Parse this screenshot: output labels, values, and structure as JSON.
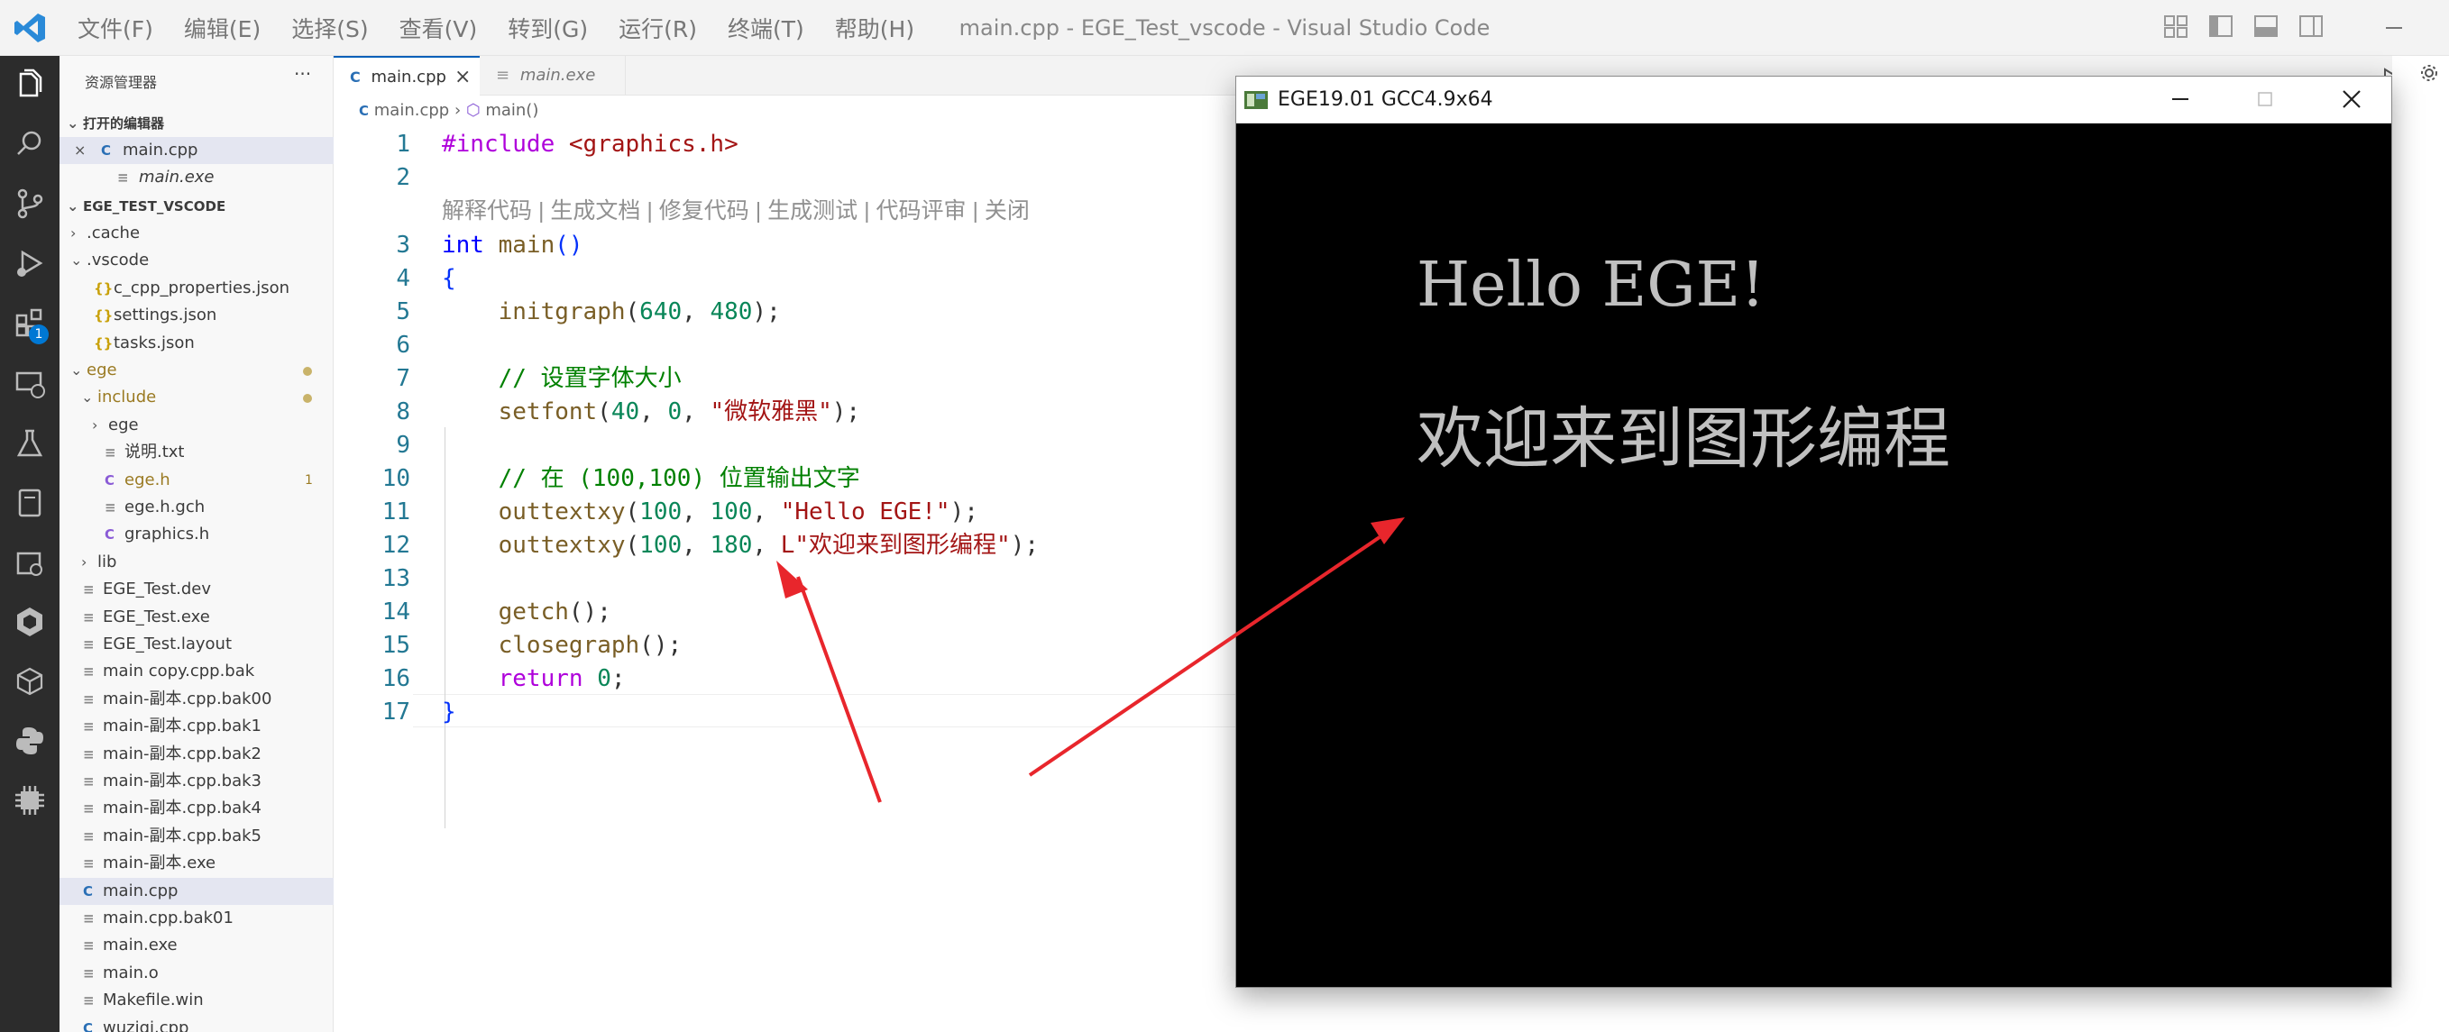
{
  "window": {
    "title": "main.cpp - EGE_Test_vscode - Visual Studio Code"
  },
  "menu": [
    "文件(F)",
    "编辑(E)",
    "选择(S)",
    "查看(V)",
    "转到(G)",
    "运行(R)",
    "终端(T)",
    "帮助(H)"
  ],
  "sidebar": {
    "title": "资源管理器",
    "more": "···",
    "open_editors_label": "打开的编辑器",
    "open_editors": [
      {
        "label": "main.cpp",
        "icon": "C"
      },
      {
        "label": "main.exe",
        "icon": "≡"
      }
    ],
    "project_label": "EGE_TEST_VSCODE",
    "tree": [
      {
        "label": ".cache",
        "chev": "›",
        "icon": ""
      },
      {
        "label": ".vscode",
        "chev": "⌄",
        "icon": ""
      },
      {
        "label": "c_cpp_properties.json",
        "chev": "",
        "icon": "{}"
      },
      {
        "label": "settings.json",
        "chev": "",
        "icon": "{}"
      },
      {
        "label": "tasks.json",
        "chev": "",
        "icon": "{}"
      },
      {
        "label": "ege",
        "chev": "⌄",
        "icon": ""
      },
      {
        "label": "include",
        "chev": "⌄",
        "icon": ""
      },
      {
        "label": "ege",
        "chev": "›",
        "icon": ""
      },
      {
        "label": "说明.txt",
        "chev": "",
        "icon": "≡"
      },
      {
        "label": "ege.h",
        "chev": "",
        "icon": "C",
        "count": "1"
      },
      {
        "label": "ege.h.gch",
        "chev": "",
        "icon": "≡"
      },
      {
        "label": "graphics.h",
        "chev": "",
        "icon": "C"
      },
      {
        "label": "lib",
        "chev": "›",
        "icon": ""
      },
      {
        "label": "EGE_Test.dev",
        "chev": "",
        "icon": "≡"
      },
      {
        "label": "EGE_Test.exe",
        "chev": "",
        "icon": "≡"
      },
      {
        "label": "EGE_Test.layout",
        "chev": "",
        "icon": "≡"
      },
      {
        "label": "main copy.cpp.bak",
        "chev": "",
        "icon": "≡"
      },
      {
        "label": "main-副本.cpp.bak00",
        "chev": "",
        "icon": "≡"
      },
      {
        "label": "main-副本.cpp.bak1",
        "chev": "",
        "icon": "≡"
      },
      {
        "label": "main-副本.cpp.bak2",
        "chev": "",
        "icon": "≡"
      },
      {
        "label": "main-副本.cpp.bak3",
        "chev": "",
        "icon": "≡"
      },
      {
        "label": "main-副本.cpp.bak4",
        "chev": "",
        "icon": "≡"
      },
      {
        "label": "main-副本.cpp.bak5",
        "chev": "",
        "icon": "≡"
      },
      {
        "label": "main-副本.exe",
        "chev": "",
        "icon": "≡"
      },
      {
        "label": "main.cpp",
        "chev": "",
        "icon": "C"
      },
      {
        "label": "main.cpp.bak01",
        "chev": "",
        "icon": "≡"
      },
      {
        "label": "main.exe",
        "chev": "",
        "icon": "≡"
      },
      {
        "label": "main.o",
        "chev": "",
        "icon": "≡"
      },
      {
        "label": "Makefile.win",
        "chev": "",
        "icon": "≡"
      },
      {
        "label": "wuziqi.cpp",
        "chev": "",
        "icon": "C"
      }
    ]
  },
  "activity_badge": "1",
  "tabs": [
    {
      "label": "main.cpp",
      "close": "×"
    },
    {
      "label": "main.exe"
    }
  ],
  "breadcrumb": {
    "file": "main.cpp",
    "sep": "›",
    "symbol": "main()"
  },
  "codelens": "解释代码 | 生成文档 | 修复代码 | 生成测试 | 代码评审 | 关闭",
  "code_lines": [
    {
      "n": "1",
      "tokens": [
        [
          "pp",
          "#include "
        ],
        [
          "inc",
          "<graphics.h>"
        ]
      ]
    },
    {
      "n": "2",
      "tokens": []
    },
    {
      "n": "3",
      "tokens": [
        [
          "kw",
          "int"
        ],
        [
          "punc",
          " "
        ],
        [
          "fn",
          "main"
        ],
        [
          "brk",
          "()"
        ]
      ]
    },
    {
      "n": "4",
      "tokens": [
        [
          "brk",
          "{"
        ]
      ]
    },
    {
      "n": "5",
      "tokens": [
        [
          "punc",
          "    "
        ],
        [
          "fn",
          "initgraph"
        ],
        [
          "punc",
          "("
        ],
        [
          "num",
          "640"
        ],
        [
          "punc",
          ", "
        ],
        [
          "num",
          "480"
        ],
        [
          "punc",
          ");"
        ]
      ]
    },
    {
      "n": "6",
      "tokens": []
    },
    {
      "n": "7",
      "tokens": [
        [
          "punc",
          "    "
        ],
        [
          "cm",
          "// 设置字体大小"
        ]
      ]
    },
    {
      "n": "8",
      "tokens": [
        [
          "punc",
          "    "
        ],
        [
          "fn",
          "setfont"
        ],
        [
          "punc",
          "("
        ],
        [
          "num",
          "40"
        ],
        [
          "punc",
          ", "
        ],
        [
          "num",
          "0"
        ],
        [
          "punc",
          ", "
        ],
        [
          "str",
          "\"微软雅黑\""
        ],
        [
          "punc",
          ");"
        ]
      ]
    },
    {
      "n": "9",
      "tokens": []
    },
    {
      "n": "10",
      "tokens": [
        [
          "punc",
          "    "
        ],
        [
          "cm",
          "// 在 (100,100) 位置输出文字"
        ]
      ]
    },
    {
      "n": "11",
      "tokens": [
        [
          "punc",
          "    "
        ],
        [
          "fn",
          "outtextxy"
        ],
        [
          "punc",
          "("
        ],
        [
          "num",
          "100"
        ],
        [
          "punc",
          ", "
        ],
        [
          "num",
          "100"
        ],
        [
          "punc",
          ", "
        ],
        [
          "str",
          "\"Hello EGE!\""
        ],
        [
          "punc",
          ");"
        ]
      ]
    },
    {
      "n": "12",
      "tokens": [
        [
          "punc",
          "    "
        ],
        [
          "fn",
          "outtextxy"
        ],
        [
          "punc",
          "("
        ],
        [
          "num",
          "100"
        ],
        [
          "punc",
          ", "
        ],
        [
          "num",
          "180"
        ],
        [
          "punc",
          ", "
        ],
        [
          "str",
          "L\"欢迎来到图形编程\""
        ],
        [
          "punc",
          ");"
        ]
      ]
    },
    {
      "n": "13",
      "tokens": []
    },
    {
      "n": "14",
      "tokens": [
        [
          "punc",
          "    "
        ],
        [
          "fn",
          "getch"
        ],
        [
          "punc",
          "();"
        ]
      ]
    },
    {
      "n": "15",
      "tokens": [
        [
          "punc",
          "    "
        ],
        [
          "fn",
          "closegraph"
        ],
        [
          "punc",
          "();"
        ]
      ]
    },
    {
      "n": "16",
      "tokens": [
        [
          "punc",
          "    "
        ],
        [
          "kw2",
          "return"
        ],
        [
          "punc",
          " "
        ],
        [
          "num",
          "0"
        ],
        [
          "punc",
          ";"
        ]
      ]
    },
    {
      "n": "17",
      "tokens": [
        [
          "brk",
          "}"
        ]
      ]
    }
  ],
  "ege_window": {
    "title": "EGE19.01 GCC4.9x64",
    "line1": "Hello EGE!",
    "line2": "欢迎来到图形编程"
  },
  "colors": {
    "arrow": "#e8262c",
    "accent": "#005fb8",
    "activity_bg": "#2c2c2c"
  }
}
